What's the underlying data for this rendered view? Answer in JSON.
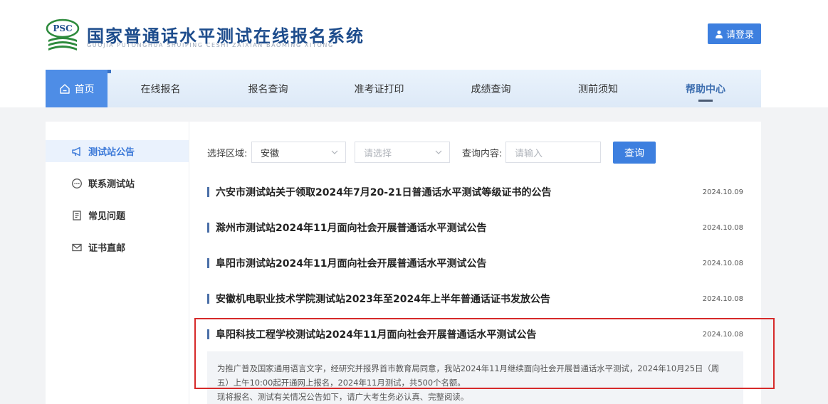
{
  "header": {
    "logo_text": "PSC",
    "title": "国家普通话水平测试在线报名系统",
    "subtitle": "GUOJIA PUTONGHUA SHUIPING CESHI ZAIXIAN BAOMING XITONG",
    "login_label": "请登录"
  },
  "nav": {
    "home": "首页",
    "online_signup": "在线报名",
    "signup_query": "报名查询",
    "ticket_print": "准考证打印",
    "score_query": "成绩查询",
    "pre_test_notice": "测前须知",
    "help_center": "帮助中心"
  },
  "sidebar": {
    "items": [
      {
        "label": "测试站公告",
        "icon": "megaphone-icon"
      },
      {
        "label": "联系测试站",
        "icon": "chat-icon"
      },
      {
        "label": "常见问题",
        "icon": "document-icon"
      },
      {
        "label": "证书直邮",
        "icon": "mail-icon"
      }
    ]
  },
  "filter": {
    "region_label": "选择区域:",
    "region_value": "安徽",
    "second_placeholder": "请选择",
    "content_label": "查询内容:",
    "content_placeholder": "请输入",
    "query_button": "查询"
  },
  "notices": [
    {
      "title": "六安市测试站关于领取2024年7月20-21日普通话水平测试等级证书的公告",
      "date": "2024.10.09"
    },
    {
      "title": "滁州市测试站2024年11月面向社会开展普通话水平测试公告",
      "date": "2024.10.08"
    },
    {
      "title": "阜阳市测试站2024年11月面向社会开展普通话水平测试公告",
      "date": "2024.10.08"
    },
    {
      "title": "安徽机电职业技术学院测试站2023年至2024年上半年普通话证书发放公告",
      "date": "2024.10.08"
    },
    {
      "title": "阜阳科技工程学校测试站2024年11月面向社会开展普通话水平测试公告",
      "date": "2024.10.08"
    }
  ],
  "excerpt": {
    "line1": "为推广普及国家通用语言文字，经研究并报界首市教育局同意，我站2024年11月继续面向社会开展普通话水平测试，2024年10月25日（周",
    "line2": "五）上午10:00起开通网上报名，2024年11月测试，共500个名额。",
    "line3": "现将报名、测试有关情况公告如下，请广大考生务必认真、完整阅读。"
  },
  "colors": {
    "primary": "#3d7fdf",
    "nav_active": "#4e8de6",
    "highlight_border": "#d62a2a"
  }
}
